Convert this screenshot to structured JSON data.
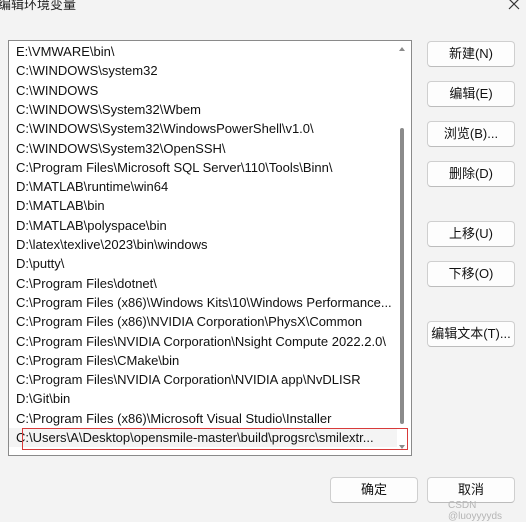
{
  "window": {
    "title": "编辑环境变量"
  },
  "paths": [
    "E:\\VMWARE\\bin\\",
    "C:\\WINDOWS\\system32",
    "C:\\WINDOWS",
    "C:\\WINDOWS\\System32\\Wbem",
    "C:\\WINDOWS\\System32\\WindowsPowerShell\\v1.0\\",
    "C:\\WINDOWS\\System32\\OpenSSH\\",
    "C:\\Program Files\\Microsoft SQL Server\\110\\Tools\\Binn\\",
    "D:\\MATLAB\\runtime\\win64",
    "D:\\MATLAB\\bin",
    "D:\\MATLAB\\polyspace\\bin",
    "D:\\latex\\texlive\\2023\\bin\\windows",
    "D:\\putty\\",
    "C:\\Program Files\\dotnet\\",
    "C:\\Program Files (x86)\\Windows Kits\\10\\Windows Performance...",
    "C:\\Program Files (x86)\\NVIDIA Corporation\\PhysX\\Common",
    "C:\\Program Files\\NVIDIA Corporation\\Nsight Compute 2022.2.0\\",
    "C:\\Program Files\\CMake\\bin",
    "C:\\Program Files\\NVIDIA Corporation\\NVIDIA app\\NvDLISR",
    "D:\\Git\\bin",
    "C:\\Program Files (x86)\\Microsoft Visual Studio\\Installer",
    "C:\\Users\\A\\Desktop\\opensmile-master\\build\\progsrc\\smilextr..."
  ],
  "buttons": {
    "new": "新建(N)",
    "edit": "编辑(E)",
    "browse": "浏览(B)...",
    "delete": "删除(D)",
    "move_up": "上移(U)",
    "move_down": "下移(O)",
    "edit_text": "编辑文本(T)...",
    "ok": "确定",
    "cancel": "取消"
  },
  "watermark": "CSDN @luoyyyyds",
  "colors": {
    "highlight": "#d83a3a"
  }
}
